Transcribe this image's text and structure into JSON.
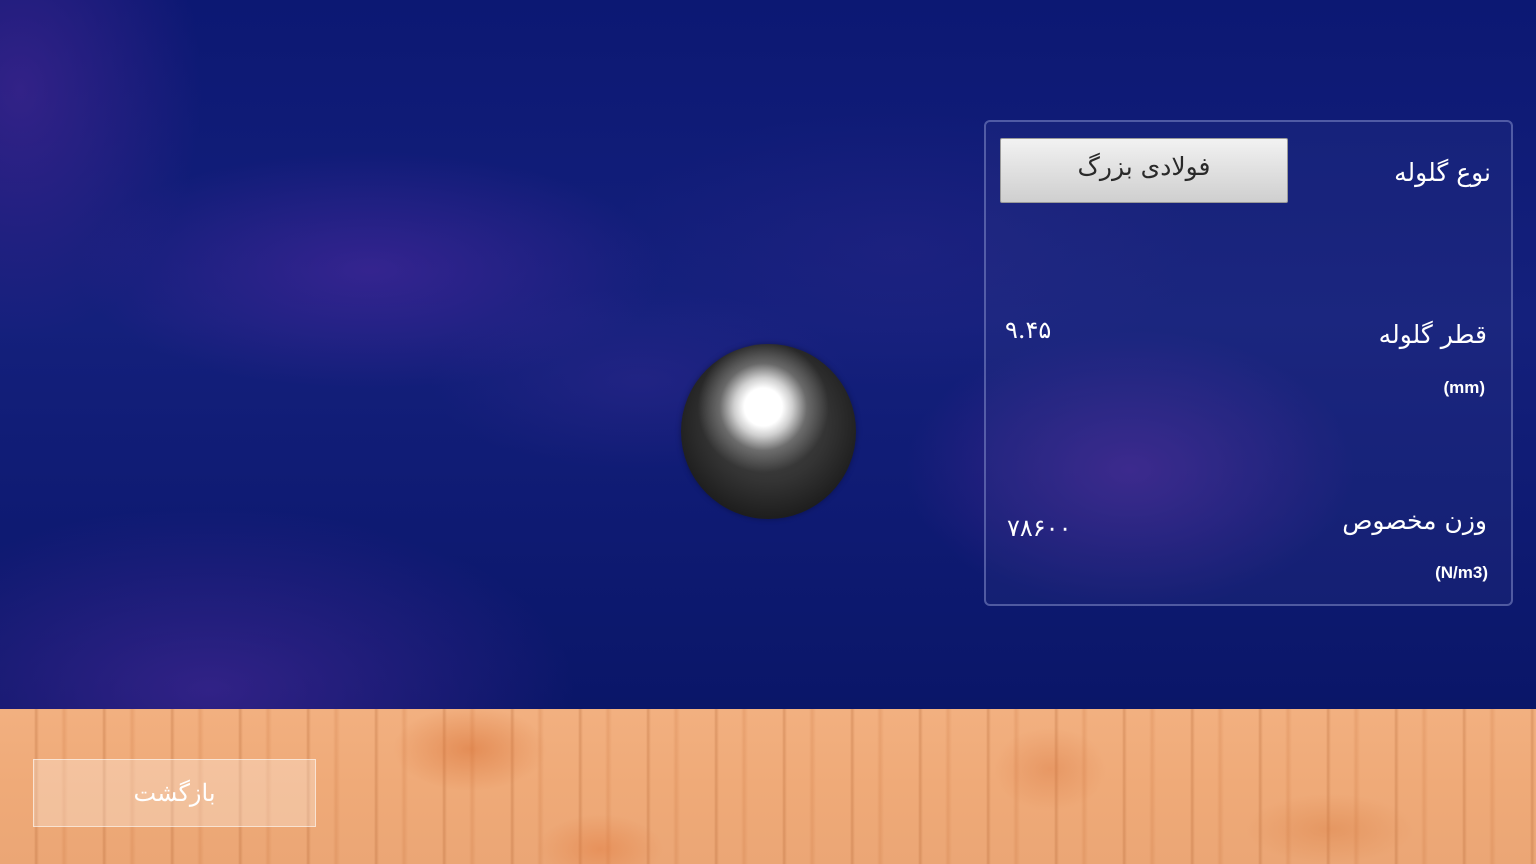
{
  "panel": {
    "type_label": "نوع گلوله",
    "type_button": "فولادی بزرگ",
    "diameter_label": "قطر گلوله",
    "diameter_value": "۹.۴۵",
    "diameter_unit": "(mm)",
    "weight_label": "وزن مخصوص",
    "weight_value": "۷۸۶۰۰",
    "weight_unit": "(N/m3)"
  },
  "footer": {
    "back_button": "بازگشت"
  },
  "colors": {
    "sky": "#0e1a72",
    "floor": "#efaa78",
    "button_face": "#e2e2e2"
  },
  "icons": {
    "ball": "steel-ball"
  }
}
